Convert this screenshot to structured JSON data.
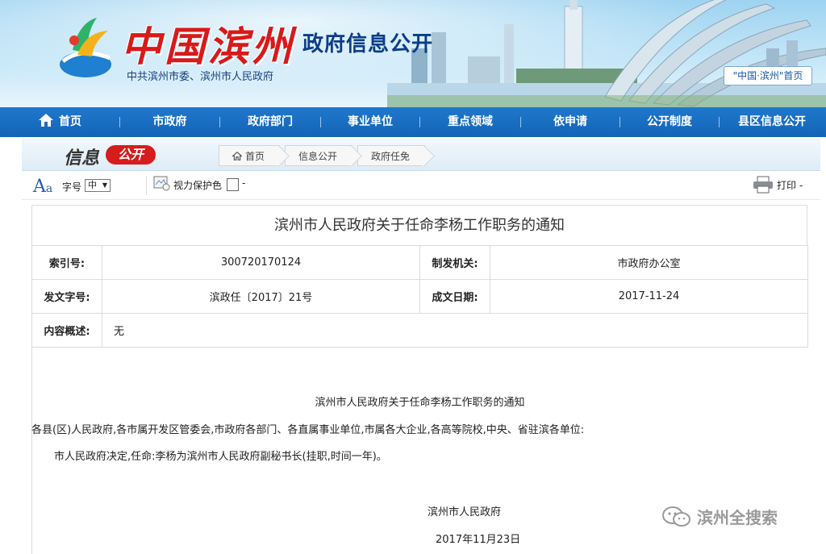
{
  "header": {
    "logo_text": "中国滨州",
    "logo_sub": "中共滨州市委、滨州市人民政府",
    "section_title": "政府信息公开",
    "home_link": "\"中国·滨州\"首页"
  },
  "nav": {
    "items": [
      "首页",
      "市政府",
      "政府部门",
      "事业单位",
      "重点领域",
      "依申请",
      "公开制度",
      "县区信息公开"
    ]
  },
  "subheader": {
    "logo_text": "信息",
    "logo_badge": "公开",
    "breadcrumb": [
      "首页",
      "信息公开",
      "政府任免"
    ]
  },
  "toolbar": {
    "font_label": "字号",
    "font_size_value": "中",
    "eye_label": "视力保护色",
    "eye_dash": "-",
    "print_label": "打印 -"
  },
  "doc": {
    "title": "滨州市人民政府关于任命李杨工作职务的通知",
    "index_label": "索引号:",
    "index_value": "300720170124",
    "issuer_label": "制发机关:",
    "issuer_value": "市政府办公室",
    "docno_label": "发文字号:",
    "docno_value": "滨政任〔2017〕21号",
    "date_label": "成文日期:",
    "date_value": "2017-11-24",
    "summary_label": "内容概述:",
    "summary_value": "无"
  },
  "article": {
    "title": "滨州市人民政府关于任命李杨工作职务的通知",
    "addressees": "各县(区)人民政府,各市属开发区管委会,市政府各部门、各直属事业单位,市属各大企业,各高等院校,中央、省驻滨各单位:",
    "paragraph": "市人民政府决定,任命:李杨为滨州市人民政府副秘书长(挂职,时间一年)。",
    "signature": "滨州市人民政府",
    "date": "2017年11月23日"
  },
  "watermark": {
    "text": "滨州全搜索"
  },
  "colors": {
    "nav_bg": "#1a6ec2",
    "logo_red": "#d81a1a",
    "title_blue": "#0d3d87"
  }
}
